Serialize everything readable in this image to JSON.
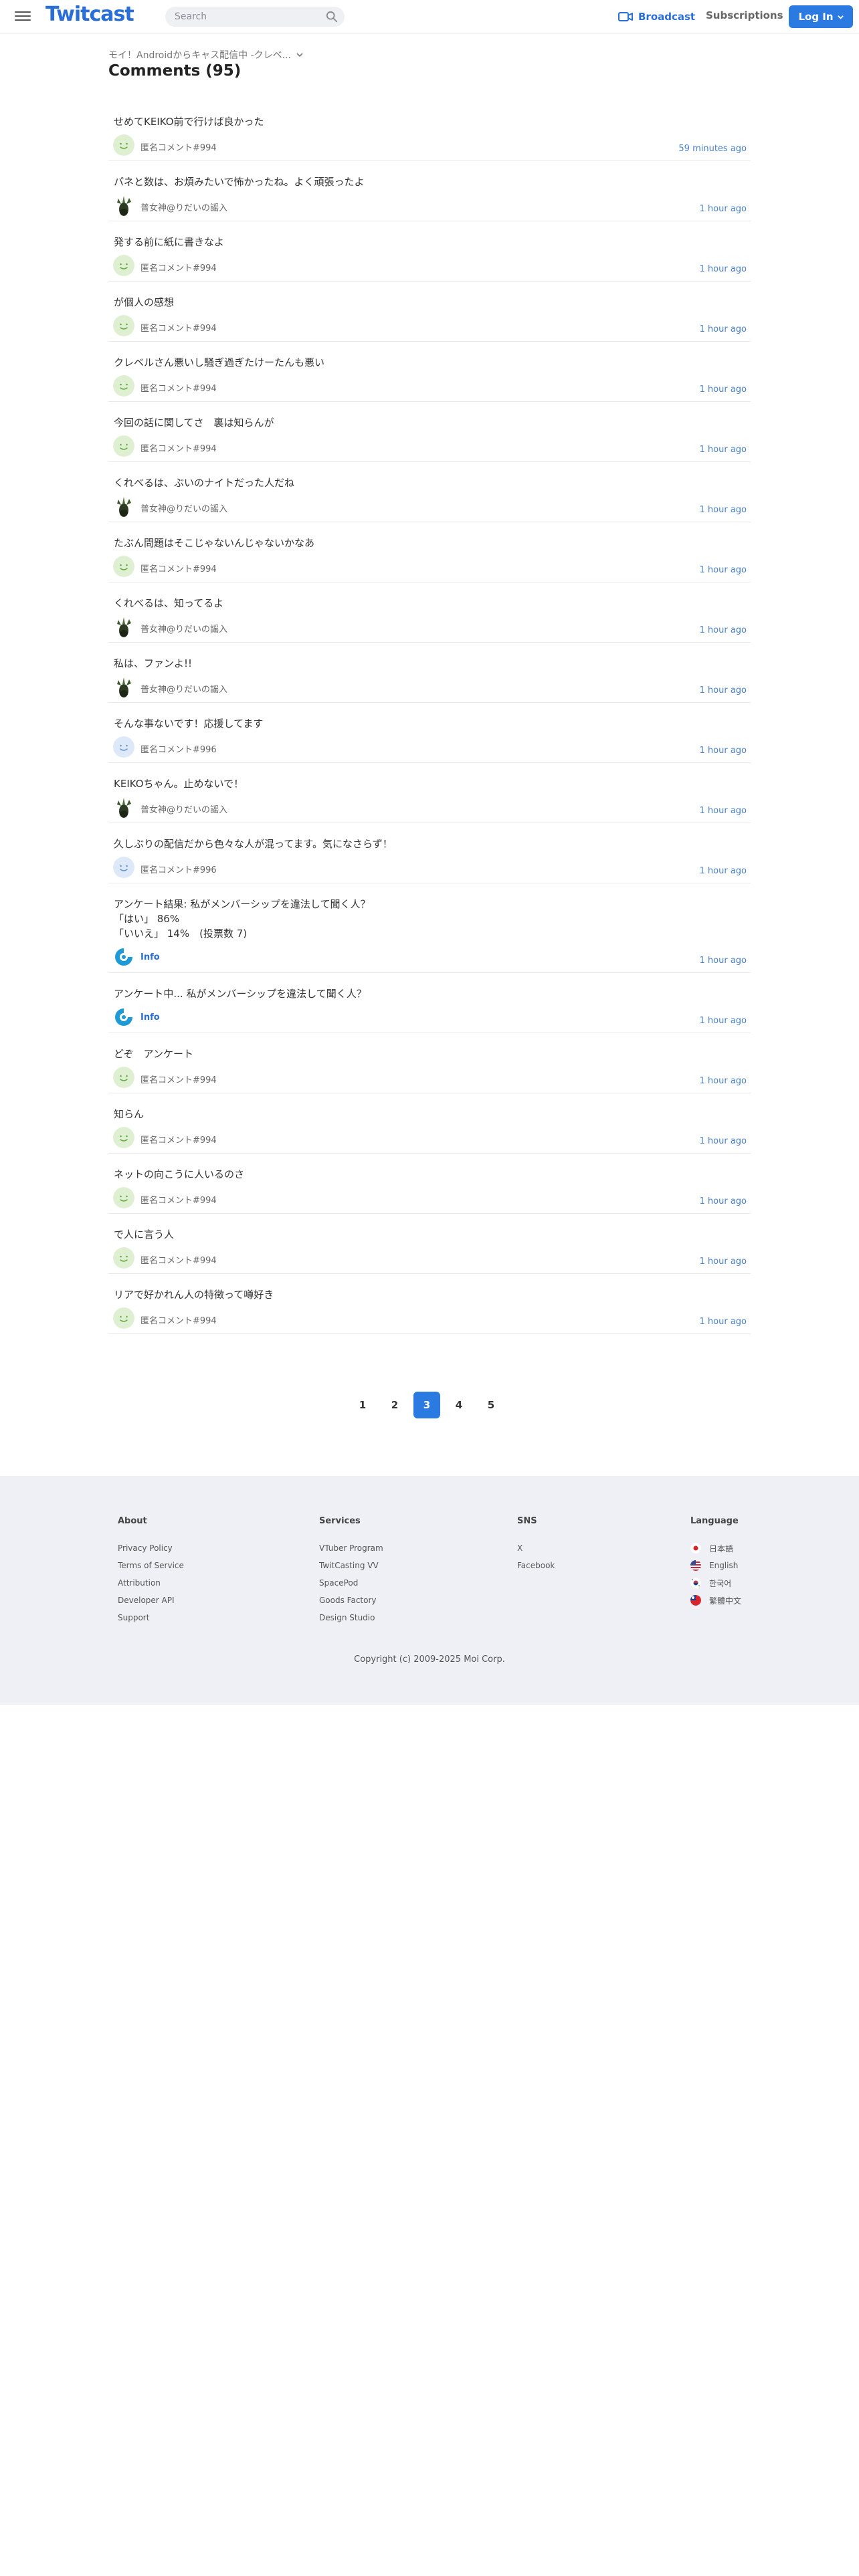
{
  "header": {
    "logo": "Twitcast",
    "search_placeholder": "Search",
    "broadcast_label": "Broadcast",
    "subscriptions_label": "Subscriptions",
    "login_label": "Log In"
  },
  "page": {
    "breadcrumb": "モイ！Androidからキャス配信中 -クレベ...",
    "title": "Comments (95)"
  },
  "comments": [
    {
      "text": "せめてKEIKO前で行けば良かった",
      "user": "匿名コメント#994",
      "time": "59 minutes ago",
      "avatar": "smiley-green"
    },
    {
      "text": "パネと数は、お煩みたいで怖かったね。よく頑張ったよ",
      "user": "普女神@りだいの謡入",
      "time": "1 hour ago",
      "avatar": "plant"
    },
    {
      "text": "発する前に紙に書きなよ",
      "user": "匿名コメント#994",
      "time": "1 hour ago",
      "avatar": "smiley-green"
    },
    {
      "text": "が個人の感想",
      "user": "匿名コメント#994",
      "time": "1 hour ago",
      "avatar": "smiley-green"
    },
    {
      "text": "クレベルさん悪いし騒ぎ過ぎたけーたんも悪い",
      "user": "匿名コメント#994",
      "time": "1 hour ago",
      "avatar": "smiley-green"
    },
    {
      "text": "今回の話に関してさ　裏は知らんが",
      "user": "匿名コメント#994",
      "time": "1 hour ago",
      "avatar": "smiley-green"
    },
    {
      "text": "くれべるは、ぶいのナイトだった人だね",
      "user": "普女神@りだいの謡入",
      "time": "1 hour ago",
      "avatar": "plant"
    },
    {
      "text": "たぶん問題はそこじゃないんじゃないかなあ",
      "user": "匿名コメント#994",
      "time": "1 hour ago",
      "avatar": "smiley-green"
    },
    {
      "text": "くれべるは、知ってるよ",
      "user": "普女神@りだいの謡入",
      "time": "1 hour ago",
      "avatar": "plant"
    },
    {
      "text": "私は、ファンよ!!",
      "user": "普女神@りだいの謡入",
      "time": "1 hour ago",
      "avatar": "plant"
    },
    {
      "text": "そんな事ないです！応援してます",
      "user": "匿名コメント#996",
      "time": "1 hour ago",
      "avatar": "smiley-blue"
    },
    {
      "text": "KEIKOちゃん。止めないで！",
      "user": "普女神@りだいの謡入",
      "time": "1 hour ago",
      "avatar": "plant"
    },
    {
      "text": "久しぶりの配信だから色々な人が混ってます。気になさらず！",
      "user": "匿名コメント#996",
      "time": "1 hour ago",
      "avatar": "smiley-blue"
    },
    {
      "text": "アンケート結果: 私がメンバーシップを違法して聞く人？\n「はい」 86%\n「いいえ」 14%　(投票数 7)",
      "user": "Info",
      "time": "1 hour ago",
      "avatar": "info"
    },
    {
      "text": "アンケート中... 私がメンバーシップを違法して聞く人？",
      "user": "Info",
      "time": "1 hour ago",
      "avatar": "info"
    },
    {
      "text": "どぞ　アンケート",
      "user": "匿名コメント#994",
      "time": "1 hour ago",
      "avatar": "smiley-green"
    },
    {
      "text": "知らん",
      "user": "匿名コメント#994",
      "time": "1 hour ago",
      "avatar": "smiley-green"
    },
    {
      "text": "ネットの向こうに人いるのさ",
      "user": "匿名コメント#994",
      "time": "1 hour ago",
      "avatar": "smiley-green"
    },
    {
      "text": "で人に言う人",
      "user": "匿名コメント#994",
      "time": "1 hour ago",
      "avatar": "smiley-green"
    },
    {
      "text": "リアで好かれん人の特徴って噂好き",
      "user": "匿名コメント#994",
      "time": "1 hour ago",
      "avatar": "smiley-green"
    }
  ],
  "pagination": {
    "pages": [
      "1",
      "2",
      "3",
      "4",
      "5"
    ],
    "current": "3"
  },
  "footer": {
    "about": {
      "title": "About",
      "links": [
        "Privacy Policy",
        "Terms of Service",
        "Attribution",
        "Developer API",
        "Support"
      ]
    },
    "services": {
      "title": "Services",
      "links": [
        "VTuber Program",
        "TwitCasting VV",
        "SpacePod",
        "Goods Factory",
        "Design Studio"
      ]
    },
    "sns": {
      "title": "SNS",
      "links": [
        "X",
        "Facebook"
      ]
    },
    "language": {
      "title": "Language",
      "links": [
        "日本語",
        "English",
        "한국어",
        "繁體中文"
      ]
    },
    "copyright": "Copyright (c) 2009-2025 Moi Corp."
  },
  "colors": {
    "accent": "#2a7ae2",
    "link": "#4a80c9",
    "footer_bg": "#eef0f6"
  }
}
